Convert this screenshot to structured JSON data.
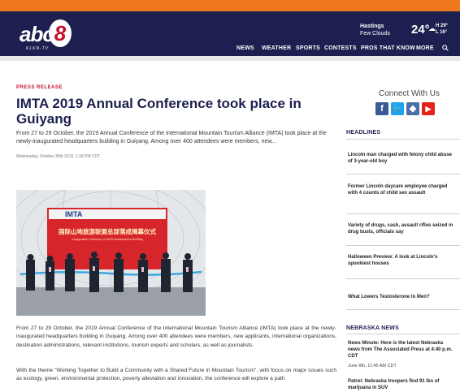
{
  "header": {
    "station_logo": "abc 8",
    "call_letters": "KLKN-TV",
    "weather": {
      "city": "Hastings",
      "condition": "Few Clouds",
      "temp": "24°",
      "high": "H 29°",
      "low": "L 16°",
      "icon": "partly-cloudy-icon"
    },
    "nav": [
      "NEWS",
      "WEATHER",
      "SPORTS",
      "CONTESTS",
      "PROS THAT KNOW",
      "MORE"
    ]
  },
  "article": {
    "kicker": "PRESS RELEASE",
    "title": "IMTA 2019 Annual Conference took place in Guiyang",
    "summary": "From 27 to 29 October, the 2019 Annual Conference of the International Mountain Tourism Alliance (IMTA) took place at the newly-inaugurated headquarters building in Guiyang. Among over 400 attendees were members, new...",
    "dateline": "Wednesday, October 30th 2019, 1:18 PM CDT",
    "photo": {
      "logo": "IMTA",
      "banner_line1": "国际山地旅游联盟总部落成揭幕仪式",
      "banner_line2": "Inauguration Ceremony of IMTA Headquarters Building"
    },
    "paragraphs": [
      "From 27 to 29 October, the 2019 Annual Conference of the International Mountain Tourism Alliance (IMTA) took place at the newly-inaugurated headquarters building in Guiyang. Among over 400 attendees were members, new applicants, international organizations, destination administrations, relevant institutions, tourism experts and scholars, as well as journalists.",
      "With the theme \"Working Together to Build a Community with a Shared Future in Mountain Tourism\", with focus on major issues such as ecology, green, environmental protection, poverty alleviation and innovation, the conference will explore a path"
    ]
  },
  "sidebar": {
    "connect_label": "Connect With Us",
    "social": [
      {
        "icon": "facebook-icon",
        "glyph": "f",
        "color": "#3b5998"
      },
      {
        "icon": "twitter-icon",
        "glyph": "t",
        "color": "#1da1f2"
      },
      {
        "icon": "app-icon",
        "glyph": "◆",
        "color": "#4a6fa5"
      },
      {
        "icon": "youtube-icon",
        "glyph": "▶",
        "color": "#e62117"
      }
    ],
    "headlines_title": "HEADLINES",
    "headlines": [
      "Lincoln man charged with felony child abuse of 3-year-old boy",
      "Former Lincoln daycare employee charged with 4 counts of child sex assault",
      "Variety of drugs, cash, assault rifles seized in drug busts, officials say",
      "Halloween Preview: A look at Lincoln's spookiest houses",
      "What Lowers Testosterone In Men?"
    ],
    "nebraska_title": "NEBRASKA NEWS",
    "nebraska": [
      {
        "title": "News Minute: Here is the latest Nebraska news from The Associated Press at 4:40 p.m. CDT",
        "date": "June 8th, 11:45 AM CDT"
      },
      {
        "title": "Patrol: Nebraska troopers find 91 lbs of marijuana in SUV",
        "date": ""
      }
    ]
  },
  "colors": {
    "accent_orange": "#f0781e",
    "header_navy": "#1c1f4f",
    "kicker_red": "#c8102e"
  }
}
